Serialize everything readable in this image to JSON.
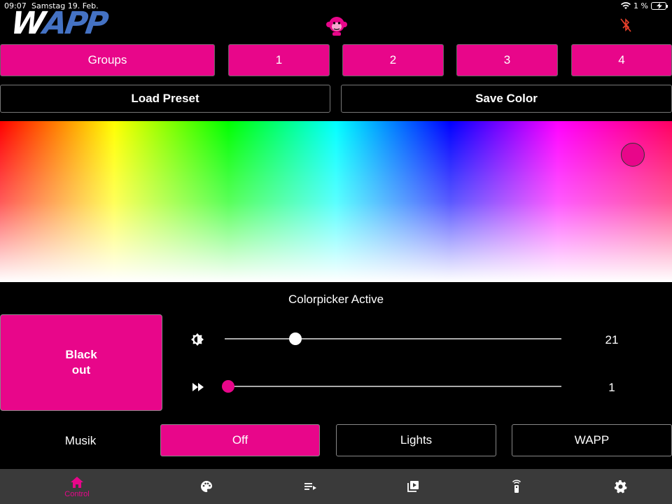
{
  "status_bar": {
    "time": "09:07",
    "date": "Samstag 19. Feb.",
    "battery": "1 %"
  },
  "header": {
    "logo_text": "WAPP",
    "icons": [
      "monkey-logo-icon",
      "bluetooth-disabled-icon"
    ]
  },
  "groups": {
    "groups_label": "Groups",
    "group_1": "1",
    "group_2": "2",
    "group_3": "3",
    "group_4": "4"
  },
  "presets": {
    "load_label": "Load Preset",
    "save_label": "Save Color"
  },
  "colorpicker": {
    "status": "Colorpicker Active",
    "selected_color": "#e8068a"
  },
  "controls": {
    "blackout_label": "Black\nout",
    "brightness": {
      "icon": "brightness-icon",
      "value": "21",
      "level": 0.21
    },
    "speed": {
      "icon": "fast-forward-icon",
      "value": "1",
      "level": 0.01
    }
  },
  "music": {
    "label": "Musik",
    "off_label": "Off",
    "lights_label": "Lights",
    "wapp_label": "WAPP"
  },
  "tabbar": {
    "control_label": "Control",
    "icons": [
      "home-icon",
      "palette-icon",
      "playlist-icon",
      "video-library-icon",
      "remote-icon",
      "settings-icon"
    ]
  },
  "colors": {
    "accent": "#e8068a",
    "background": "#000000",
    "tabbar": "#3a3a3a",
    "bluetooth": "#e8402a"
  }
}
